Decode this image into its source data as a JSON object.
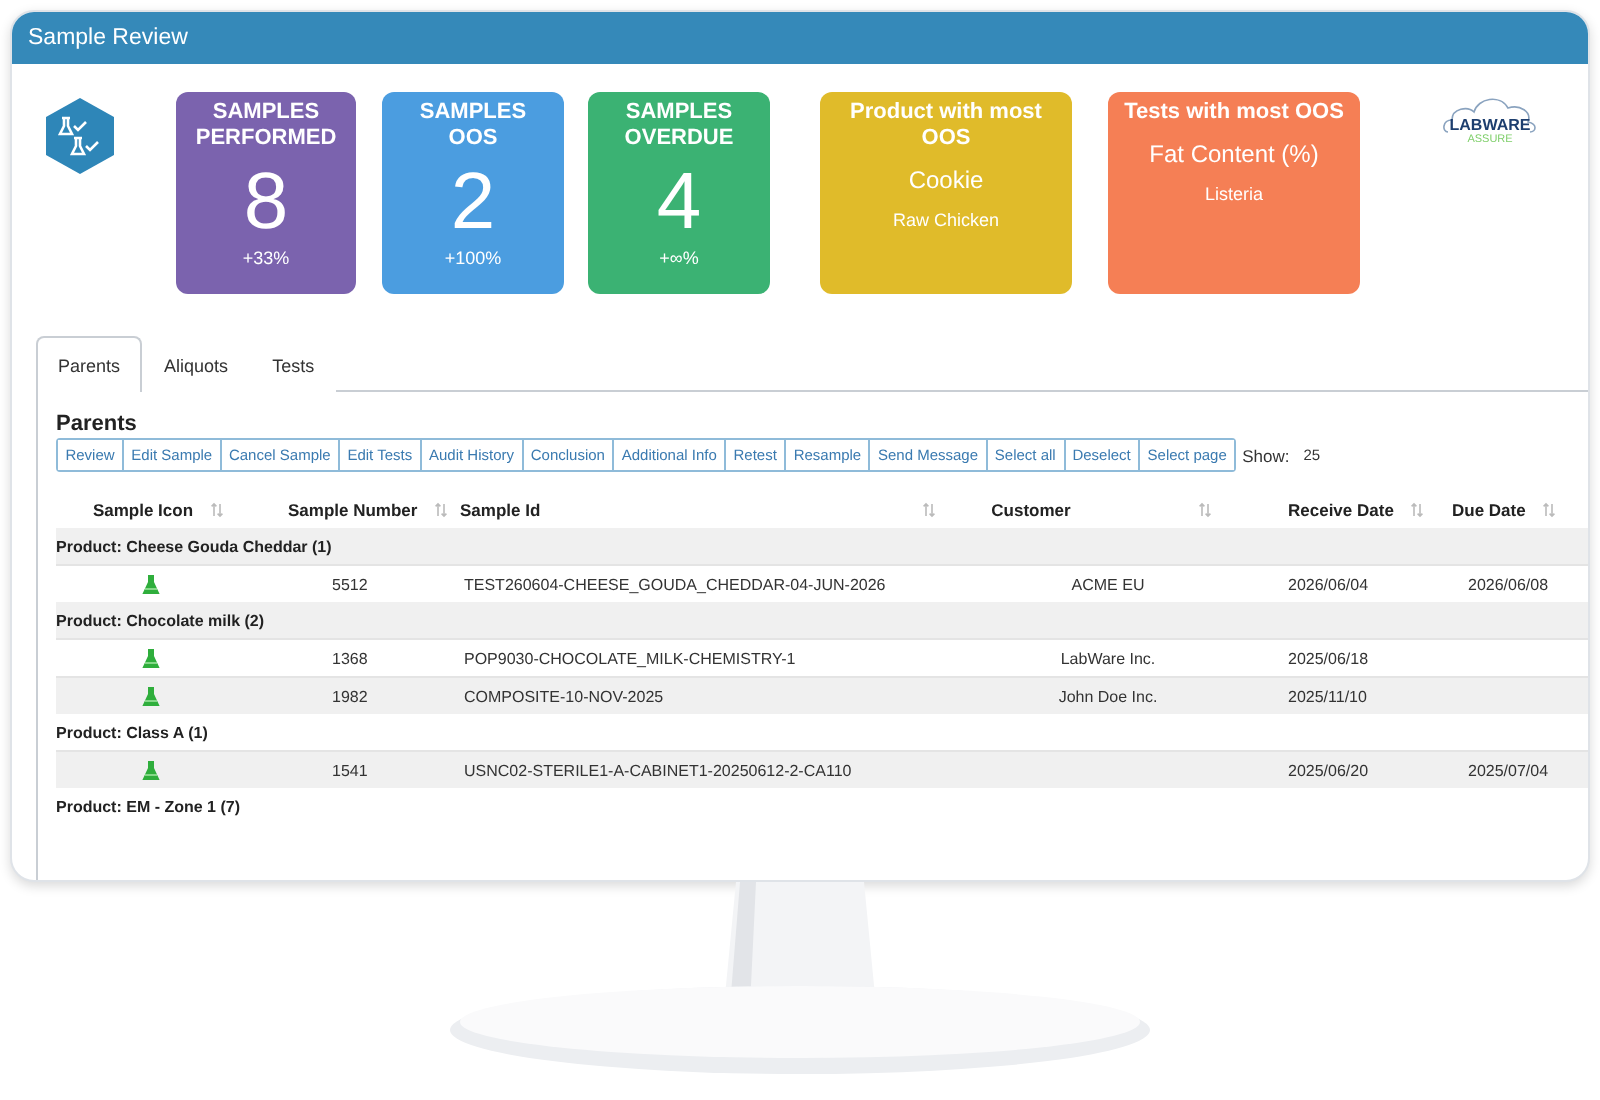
{
  "window": {
    "title": "Sample Review"
  },
  "cards": [
    {
      "kind": "metric",
      "color": "#7b63ae",
      "title": "SAMPLES PERFORMED",
      "value": "8",
      "change": "+33%"
    },
    {
      "kind": "metric",
      "color": "#4b9de0",
      "title": "SAMPLES OOS",
      "value": "2",
      "change": "+100%"
    },
    {
      "kind": "metric",
      "color": "#3bb273",
      "title": "SAMPLES OVERDUE",
      "value": "4",
      "change": "+∞%"
    },
    {
      "kind": "top",
      "color": "#e0bb2a",
      "title": "Product with most OOS",
      "items": [
        "Cookie",
        "Raw Chicken"
      ]
    },
    {
      "kind": "top",
      "color": "#f57f55",
      "title": "Tests with most OOS",
      "items": [
        "Fat Content (%)",
        "Listeria"
      ]
    }
  ],
  "logo": {
    "name": "LABWARE",
    "tagline": "ASSURE"
  },
  "tabs": [
    {
      "label": "Parents",
      "selected": true
    },
    {
      "label": "Aliquots",
      "selected": false
    },
    {
      "label": "Tests",
      "selected": false
    }
  ],
  "section_title": "Parents",
  "actions": [
    "Review",
    "Edit Sample",
    "Cancel Sample",
    "Edit Tests",
    "Audit History",
    "Conclusion",
    "Additional Info",
    "Retest",
    "Resample",
    "Send Message",
    "Select all",
    "Deselect",
    "Select page"
  ],
  "show": {
    "label": "Show:",
    "value": "25"
  },
  "table": {
    "columns": [
      "Sample Icon",
      "Sample Number",
      "Sample Id",
      "Customer",
      "Receive Date",
      "Due Date"
    ],
    "groups": [
      {
        "label": "Product: Cheese Gouda Cheddar (1)",
        "rows": [
          {
            "sample_number": "5512",
            "sample_id": "TEST260604-CHEESE_GOUDA_CHEDDAR-04-JUN-2026",
            "customer": "ACME EU",
            "receive_date": "2026/06/04",
            "due_date": "2026/06/08"
          }
        ]
      },
      {
        "label": "Product: Chocolate milk (2)",
        "rows": [
          {
            "sample_number": "1368",
            "sample_id": "POP9030-CHOCOLATE_MILK-CHEMISTRY-1",
            "customer": "LabWare Inc.",
            "receive_date": "2025/06/18"
          },
          {
            "sample_number": "1982",
            "sample_id": "COMPOSITE-10-NOV-2025",
            "customer": "John Doe Inc.",
            "receive_date": "2025/11/10"
          }
        ]
      },
      {
        "label": "Product: Class A (1)",
        "rows": [
          {
            "sample_number": "1541",
            "sample_id": "USNC02-STERILE1-A-CABINET1-20250612-2-CA110",
            "receive_date": "2025/06/20",
            "due_date": "2025/07/04"
          }
        ]
      },
      {
        "label": "Product: EM - Zone 1 (7)"
      }
    ]
  }
}
